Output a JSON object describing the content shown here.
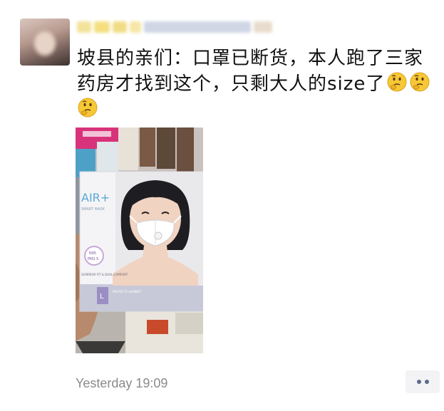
{
  "post": {
    "text": "坡县的亲们：口罩已断货，本人跑了三家药房才找到这个，只剩大人的size了",
    "emojis": [
      "thinking-face",
      "thinking-face",
      "thinking-face"
    ],
    "timestamp": "Yesterday 19:09"
  },
  "photo": {
    "brand": "AIR+",
    "subtitle": "SMART MASK",
    "size_label": "L",
    "protects": "PROTECTS AGAINST",
    "features": "SUPERIOR FIT & DUAL COMFORT",
    "n95": "N95",
    "pm25": "PM2.5"
  },
  "colors": {
    "text": "#111111",
    "timestamp": "#8a8a8a",
    "more_dots": "#5b6b8c",
    "more_bg": "#f3f3f5"
  }
}
